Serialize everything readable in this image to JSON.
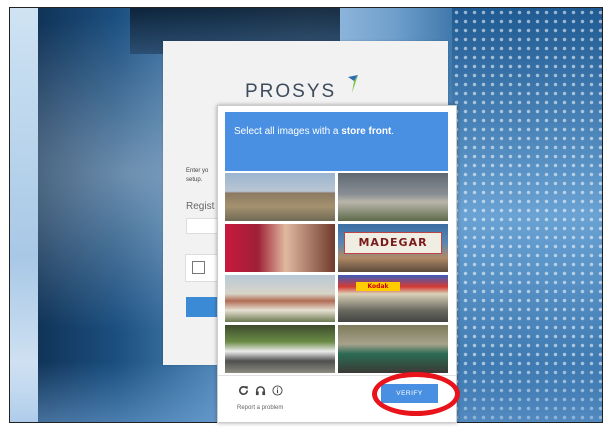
{
  "login": {
    "logo_text": "PROSYS",
    "intro_text_1": "Enter yo",
    "intro_text_2": "setup.",
    "register_label": "Regist"
  },
  "captcha": {
    "instruction_prefix": "Select all images with a ",
    "instruction_bold": "store front",
    "instruction_suffix": ".",
    "tiles": [
      {
        "id": 1,
        "text": ""
      },
      {
        "id": 2,
        "text": ""
      },
      {
        "id": 3,
        "text": ""
      },
      {
        "id": 4,
        "text": "MADEGAR"
      },
      {
        "id": 5,
        "text": ""
      },
      {
        "id": 6,
        "text": "Kodak"
      },
      {
        "id": 7,
        "text": ""
      },
      {
        "id": 8,
        "text": ""
      }
    ],
    "icons": {
      "reload": "reload-icon",
      "audio": "headphones-icon",
      "info": "info-icon"
    },
    "report_text": "Report a problem",
    "verify_label": "VERIFY"
  },
  "colors": {
    "accent": "#4a90e2",
    "highlight": "#e8131b"
  }
}
